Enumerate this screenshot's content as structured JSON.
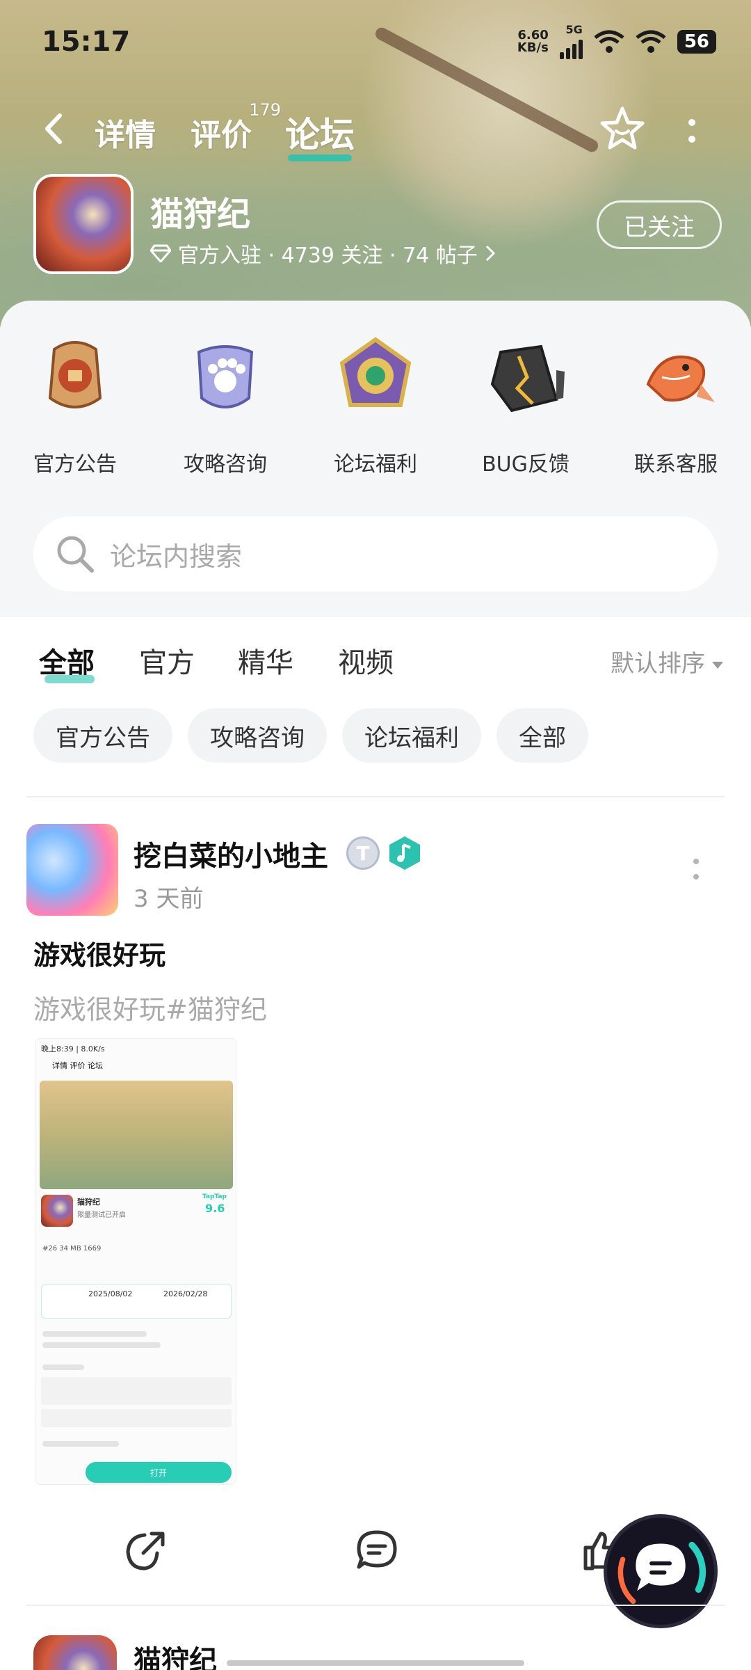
{
  "status_bar": {
    "time": "15:17",
    "net_speed": "6.60",
    "net_unit": "KB/s",
    "net_type": "5G",
    "battery": "56"
  },
  "nav": {
    "tabs": [
      {
        "label": "详情"
      },
      {
        "label": "评价",
        "count": "179"
      },
      {
        "label": "论坛",
        "active": true
      }
    ]
  },
  "game": {
    "name": "猫狩纪",
    "meta": "官方入驻 · 4739 关注 · 74 帖子",
    "follow_label": "已关注"
  },
  "categories": [
    {
      "label": "官方公告",
      "icon": "seal-icon"
    },
    {
      "label": "攻略咨询",
      "icon": "paw-shield-icon"
    },
    {
      "label": "论坛福利",
      "icon": "jade-medal-icon"
    },
    {
      "label": "BUG反馈",
      "icon": "cracked-crystal-icon"
    },
    {
      "label": "联系客服",
      "icon": "koi-fish-icon"
    }
  ],
  "search": {
    "placeholder": "论坛内搜索"
  },
  "feed_tabs": [
    {
      "label": "全部",
      "active": true
    },
    {
      "label": "官方"
    },
    {
      "label": "精华"
    },
    {
      "label": "视频"
    }
  ],
  "sort": {
    "label": "默认排序"
  },
  "chips": [
    "官方公告",
    "攻略咨询",
    "论坛福利",
    "全部"
  ],
  "post": {
    "author": "挖白菜的小地主",
    "level_badge": "T",
    "time_ago": "3 天前",
    "title": "游戏很好玩",
    "body": "游戏很好玩#猫狩纪",
    "screenshot": {
      "status": "晚上8:39 | 8.0K/s",
      "tabs": "详情  评价  论坛",
      "game_name": "猫狩纪",
      "subtitle": "限量测试已开启",
      "score_brand": "TapTap",
      "score": "9.6",
      "stats": "#26  34 MB  1669",
      "date_start": "2025/08/02",
      "date_end": "2026/02/28",
      "open_label": "打开"
    }
  },
  "next_post": {
    "name": "猫狩纪"
  },
  "colors": {
    "accent": "#26c3b0",
    "placeholder": "#a9a9a9"
  }
}
